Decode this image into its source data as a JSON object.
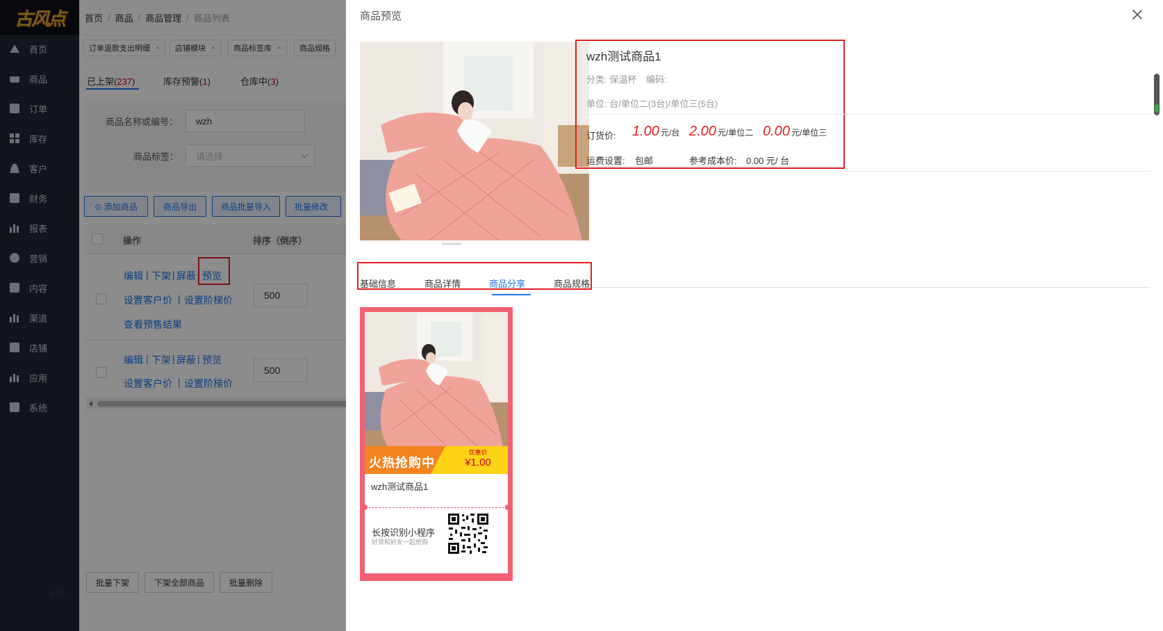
{
  "sidebar": {
    "logo": "古风点",
    "items": [
      "首页",
      "商品",
      "订单",
      "库存",
      "客户",
      "财务",
      "报表",
      "营销",
      "内容",
      "渠道",
      "店铺",
      "应用",
      "系统"
    ],
    "version": "V5.6"
  },
  "breadcrumb": [
    "首页",
    "商品",
    "商品管理",
    "商品列表"
  ],
  "page_tabs": [
    "订单退款支出明细",
    "店铺模块",
    "商品标签库",
    "商品规格"
  ],
  "status_tabs": [
    {
      "label": "已上架(",
      "count": "237",
      "end": ")"
    },
    {
      "label": "库存预警(",
      "count": "1",
      "end": ")"
    },
    {
      "label": "仓库中(",
      "count": "3",
      "end": ")"
    }
  ],
  "filter": {
    "name_label": "商品名称或编号：",
    "name_value": "wzh",
    "tag_label": "商品标签：",
    "tag_placeholder": "请选择"
  },
  "toolbar": [
    "⊙ 添加商品",
    "商品导出",
    "商品批量导入",
    "批量修改"
  ],
  "table": {
    "headers": [
      "操作",
      "排序（倒序）"
    ],
    "rows": [
      {
        "links_line1": [
          "编辑",
          "下架",
          "屏蔽",
          "预览"
        ],
        "links_line2": [
          "设置客户价",
          "设置阶梯价"
        ],
        "links_line3": "查看预售结果",
        "sort": "500"
      },
      {
        "links_line1": [
          "编辑",
          "下架",
          "屏蔽",
          "预览"
        ],
        "links_line2": [
          "设置客户价",
          "设置阶梯价"
        ],
        "sort": "500"
      }
    ],
    "separator": "|"
  },
  "footer_buttons": [
    "批量下架",
    "下架全部商品",
    "批量删除"
  ],
  "drawer": {
    "title": "商品预览",
    "product_name": "wzh测试商品1",
    "category": "分类: 保温杯",
    "code": "编码:",
    "unit": "单位: 台/单位二(3台)/单位三(5台)",
    "order_price_label": "订货价:",
    "prices": [
      {
        "value": "1.00",
        "unit": "元/台"
      },
      {
        "value": "2.00",
        "unit": "元/单位二"
      },
      {
        "value": "0.00",
        "unit": "元/单位三"
      }
    ],
    "shipping_label": "运费设置:",
    "shipping_value": "包邮",
    "cost_label": "参考成本价:",
    "cost_value": "0.00 元/ 台",
    "tabs": [
      "基础信息",
      "商品详情",
      "商品分享",
      "商品规格"
    ],
    "active_tab": "商品分享",
    "poster": {
      "banner": "火热抢购中",
      "promo_label": "优惠价",
      "promo_price": "¥1.00",
      "product_name": "wzh测试商品1",
      "qr_title": "长按识别小程序",
      "qr_sub": "好货和好友一起抢购"
    }
  },
  "colors": {
    "accent": "#1a73e8",
    "price_red": "#e02020",
    "sidebar_bg": "#1f2733",
    "highlight_frame": "#e02020",
    "poster_bg": "#f36074"
  }
}
